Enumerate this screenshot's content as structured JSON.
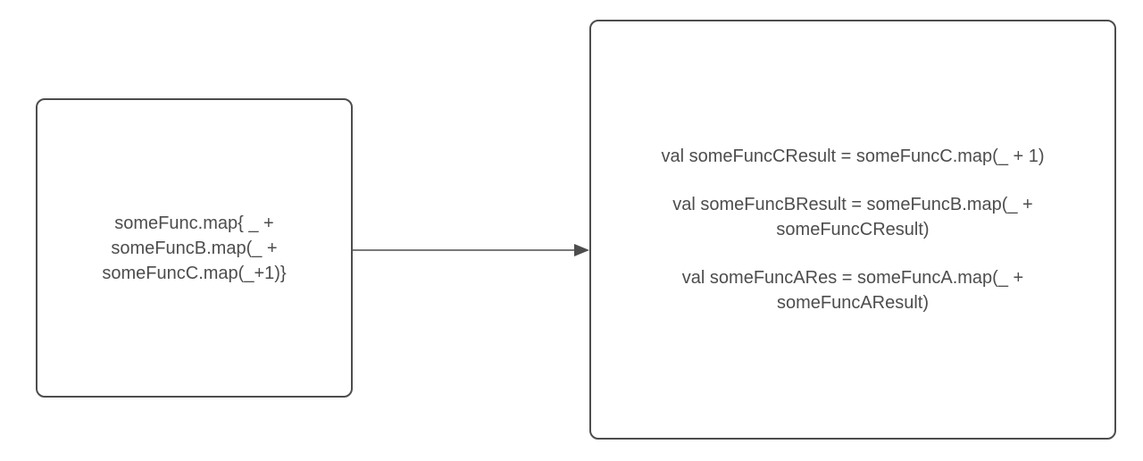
{
  "leftBox": {
    "lines": [
      "someFunc.map{ _ +",
      "someFuncB.map(_ +",
      "someFuncC.map(_+1)}"
    ]
  },
  "rightBox": {
    "blocks": [
      {
        "lines": [
          "val someFuncCResult = someFuncC.map(_ + 1)"
        ]
      },
      {
        "lines": [
          "val someFuncBResult = someFuncB.map(_ +",
          "someFuncCResult)"
        ]
      },
      {
        "lines": [
          "val someFuncARes = someFuncA.map(_ +",
          "someFuncAResult)"
        ]
      }
    ]
  }
}
